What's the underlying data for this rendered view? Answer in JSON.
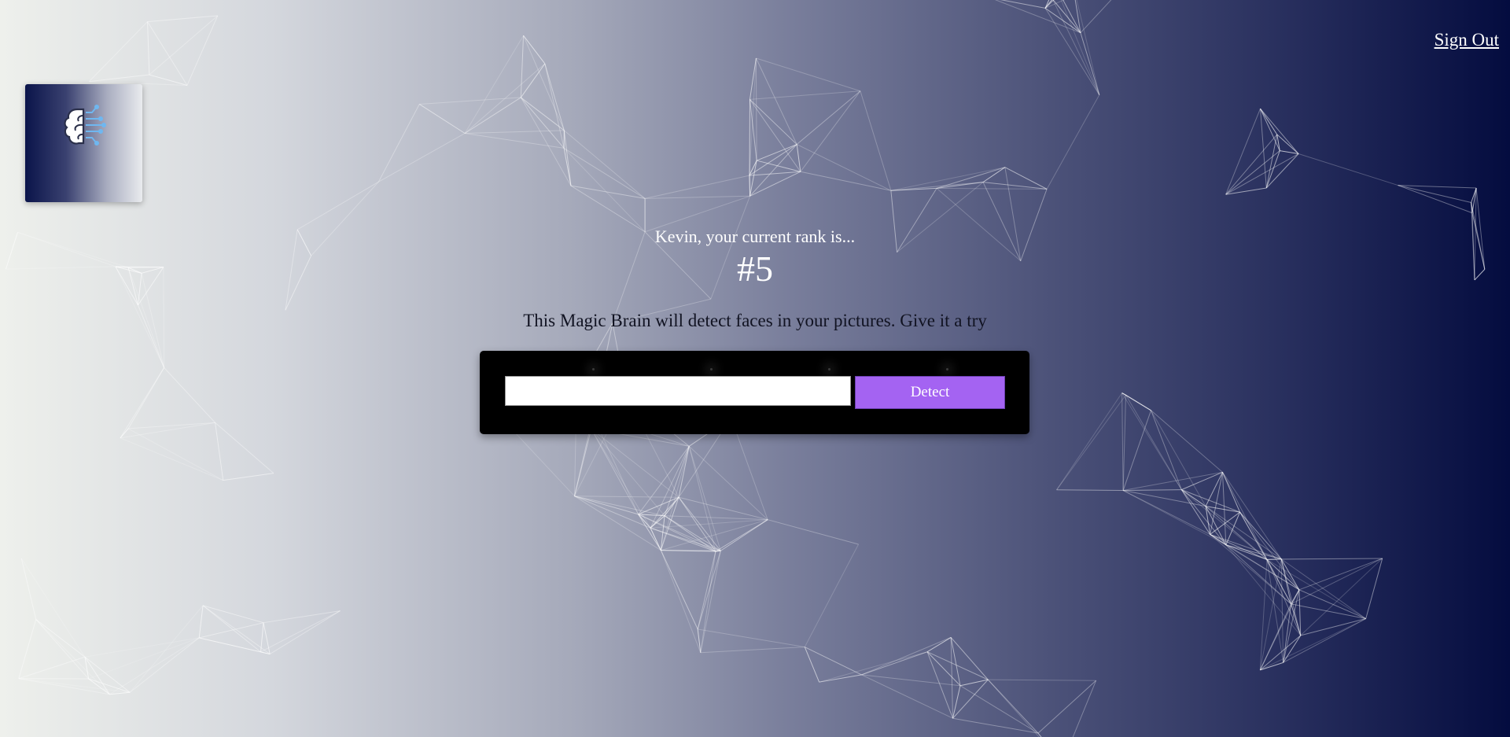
{
  "nav": {
    "signout_label": "Sign Out"
  },
  "logo": {
    "icon": "brain-circuit-icon"
  },
  "rank": {
    "text": "Kevin, your current rank is...",
    "number": "#5"
  },
  "intro": {
    "text": "This Magic Brain will detect faces in your pictures. Give it a try"
  },
  "form": {
    "input_value": "",
    "input_placeholder": "",
    "detect_label": "Detect"
  },
  "colors": {
    "detect_button": "#a463f2",
    "panel": "#000000",
    "gradient_left": "#eef0ec",
    "gradient_right": "#040c3f"
  }
}
